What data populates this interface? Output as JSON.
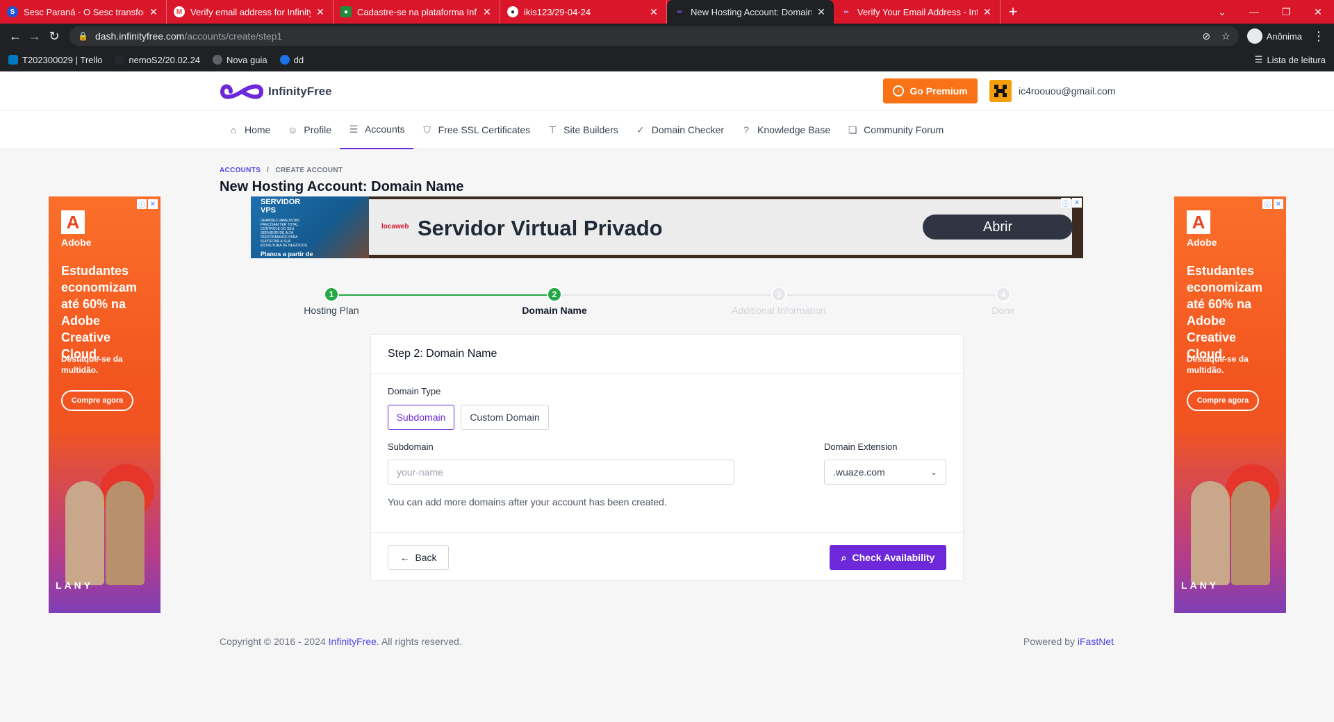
{
  "browser": {
    "tabs": [
      {
        "title": "Sesc Paraná - O Sesc transforma",
        "favicon_color": "#1a56d9"
      },
      {
        "title": "Verify email address for InfinityFr",
        "favicon_color": "#ea4335"
      },
      {
        "title": "Cadastre-se na plataforma Infinit",
        "favicon_color": "#1e8e3e"
      },
      {
        "title": "ikis123/29-04-24",
        "favicon_color": "#24292f"
      },
      {
        "title": "New Hosting Account: Domain N",
        "favicon_color": "#7c3aed"
      },
      {
        "title": "Verify Your Email Address - Infinit",
        "favicon_color": "#7c3aed"
      }
    ],
    "active_tab_index": 4,
    "url_host": "dash.infinityfree.com",
    "url_path": "/accounts/create/step1",
    "profile_label": "Anônima",
    "bookmarks": [
      {
        "label": "T202300029 | Trello",
        "color": "#0079bf"
      },
      {
        "label": "nemoS2/20.02.24",
        "color": "#24292f"
      },
      {
        "label": "Nova guia",
        "color": "#5f6368"
      },
      {
        "label": "dd",
        "color": "#1a73e8"
      }
    ],
    "reading_list": "Lista de leitura"
  },
  "header": {
    "brand": "InfinityFree",
    "premium_label": "Go Premium",
    "user_email": "ic4roouou@gmail.com"
  },
  "nav": {
    "items": [
      {
        "label": "Home",
        "icon": "home-icon"
      },
      {
        "label": "Profile",
        "icon": "user-icon"
      },
      {
        "label": "Accounts",
        "icon": "server-icon"
      },
      {
        "label": "Free SSL Certificates",
        "icon": "shield-icon"
      },
      {
        "label": "Site Builders",
        "icon": "paint-roller-icon"
      },
      {
        "label": "Domain Checker",
        "icon": "check-circle-icon"
      },
      {
        "label": "Knowledge Base",
        "icon": "question-circle-icon"
      },
      {
        "label": "Community Forum",
        "icon": "chat-icon"
      }
    ],
    "active_index": 2
  },
  "breadcrumb": {
    "parent": "ACCOUNTS",
    "separator": "/",
    "current": "CREATE ACCOUNT"
  },
  "page_title": "New Hosting Account: Domain Name",
  "top_ad": {
    "left_title": "SERVIDOR VPS",
    "left_small": "GRANDES VAREJISTAS PRECISAM TER TOTAL CONTROLE DO SEU SERVIDOR DE ALTA PERFORMANCE PARA SUPORTAR A SUA ESTRUTURA DE NEGÓCIOS.",
    "left_footer": "Planos a partir de",
    "brand": "locaweb",
    "headline": "Servidor Virtual Privado",
    "button": "Abrir"
  },
  "side_ad": {
    "brand": "Adobe",
    "headline": "Estudantes economizam até 60% na Adobe Creative Cloud.",
    "sub": "Destaque-se da multidão.",
    "cta": "Compre agora",
    "art_text": "LANY"
  },
  "steps": [
    {
      "num": "1",
      "label": "Hosting Plan",
      "state": "done"
    },
    {
      "num": "2",
      "label": "Domain Name",
      "state": "current"
    },
    {
      "num": "3",
      "label": "Additional Information",
      "state": "upcoming"
    },
    {
      "num": "4",
      "label": "Done",
      "state": "upcoming"
    }
  ],
  "form": {
    "card_title": "Step 2: Domain Name",
    "domain_type_label": "Domain Type",
    "type_options": [
      "Subdomain",
      "Custom Domain"
    ],
    "selected_type": "Subdomain",
    "subdomain_label": "Subdomain",
    "subdomain_placeholder": "your-name",
    "extension_label": "Domain Extension",
    "extension_value": ".wuaze.com",
    "help_text": "You can add more domains after your account has been created.",
    "back_label": "Back",
    "check_label": "Check Availability"
  },
  "footer": {
    "copyright_prefix": "Copyright © 2016 - 2024 ",
    "brand_link": "InfinityFree",
    "copyright_suffix": ". All rights reserved.",
    "powered_prefix": "Powered by ",
    "powered_link": "iFastNet"
  },
  "colors": {
    "brand_purple": "#6d28d9",
    "premium_orange": "#f97316",
    "step_green": "#22a845",
    "tabstrip_red": "#d9162a"
  }
}
